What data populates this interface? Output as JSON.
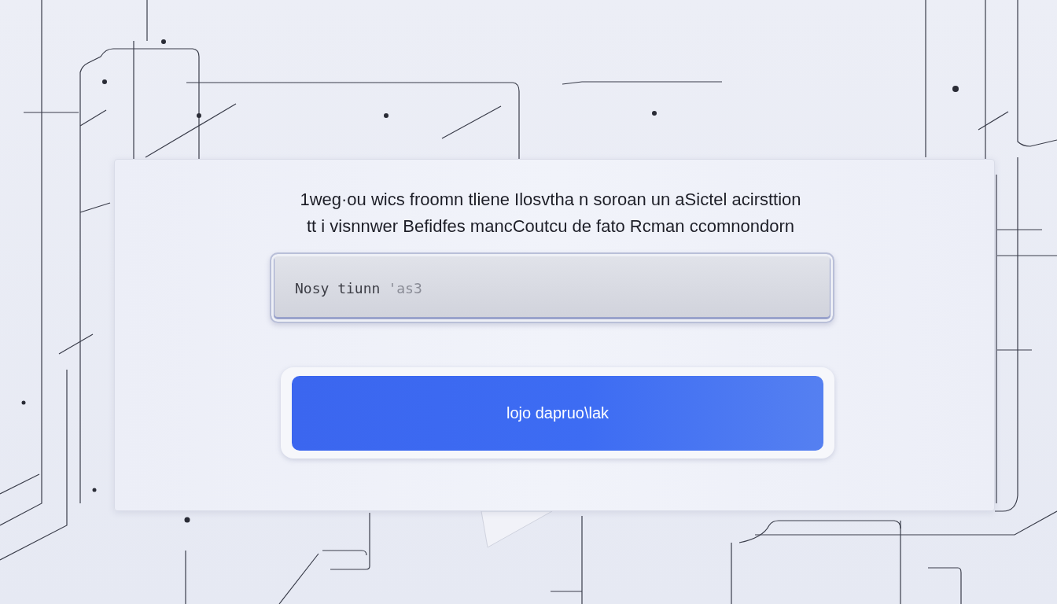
{
  "prompt": {
    "lines": [
      "1weg·ou wics froomn tliene Ilosvtha n soroan un aSictel acirsttion",
      "tt i visnnwer Befidfes mancCoutcu de fato Rcman ccomnondorn"
    ]
  },
  "input": {
    "value": "Nosy tiunn",
    "suggestion": "'as3"
  },
  "button": {
    "label": "lojo dapruo\\lak"
  }
}
